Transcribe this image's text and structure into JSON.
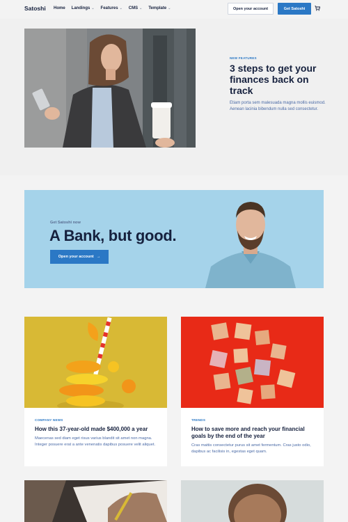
{
  "header": {
    "logo": "Satoshi",
    "nav": [
      {
        "label": "Home",
        "has_menu": false
      },
      {
        "label": "Landings",
        "has_menu": true
      },
      {
        "label": "Features",
        "has_menu": true
      },
      {
        "label": "CMS",
        "has_menu": true
      },
      {
        "label": "Template",
        "has_menu": true
      }
    ],
    "open_account_label": "Open your account",
    "get_satoshi_label": "Get Satoshi",
    "cart_icon": "cart-icon"
  },
  "hero": {
    "eyebrow": "NEW FEATURES",
    "title": "3 steps to get your finances back on track",
    "description": "Etiam porta sem malesuada magna mollis euismod. Aenean lacinia bibendum nulla sed consectetur."
  },
  "banner": {
    "eyebrow": "Get Satoshi now",
    "title": "A Bank, but good.",
    "button_label": "Open your account",
    "button_icon": "arrow-right-icon"
  },
  "cards": [
    {
      "tag": "COMPANY NEWS",
      "title": "How this 37-year-old made $400,000 a year",
      "description": "Maecenas sed diam eget risus varius blandit sit amet non magna. Integer posuere erat a ante venenatis dapibus posuere velit aliquet."
    },
    {
      "tag": "TRENDS",
      "title": "How to save more and reach your financial goals by the end of the year",
      "description": "Cras mattis consectetur purus sit amet fermentum. Cras justo odio, dapibus ac facilisis in, egestas eget quam."
    }
  ],
  "colors": {
    "accent": "#2b78c5",
    "text_dark": "#16213e",
    "banner_bg": "#a5d3ea",
    "card1_bg": "#d8b935",
    "card2_bg": "#e82a17"
  }
}
